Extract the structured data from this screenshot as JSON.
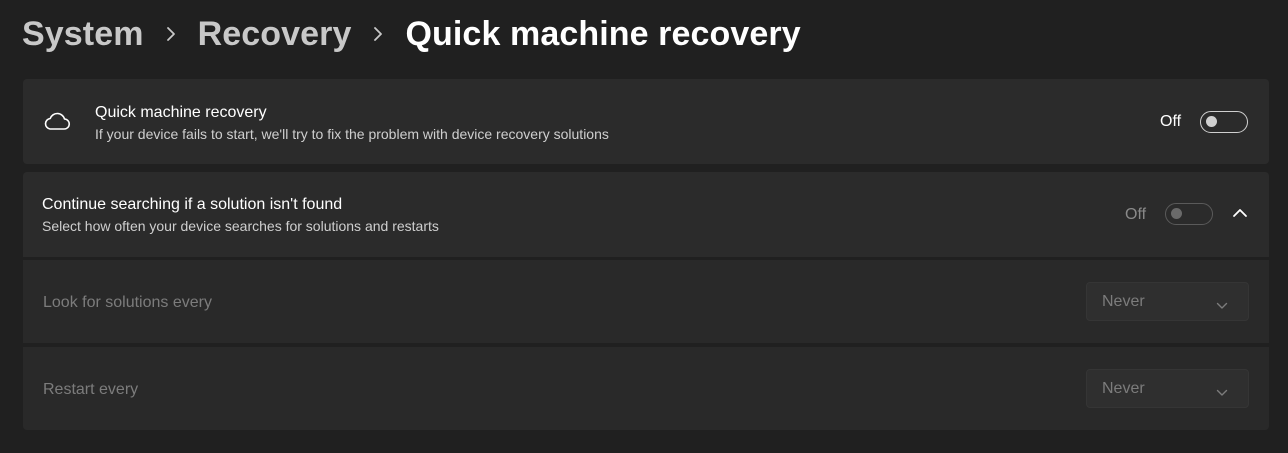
{
  "breadcrumb": {
    "items": [
      "System",
      "Recovery",
      "Quick machine recovery"
    ]
  },
  "quick_machine_recovery": {
    "title": "Quick machine recovery",
    "description": "If your device fails to start, we'll try to fix the problem with device recovery solutions",
    "toggle_state": "Off",
    "icon": "cloud-icon"
  },
  "continue_searching": {
    "title": "Continue searching if a solution isn't found",
    "description": "Select how often your device searches for solutions and restarts",
    "toggle_state": "Off",
    "icon": "chevron-up-icon"
  },
  "look_for_solutions": {
    "label": "Look for solutions every",
    "selected": "Never"
  },
  "restart": {
    "label": "Restart every",
    "selected": "Never"
  },
  "colors": {
    "background": "#202020",
    "card": "#2b2b2b",
    "disabled_text": "#7c7c7c"
  }
}
